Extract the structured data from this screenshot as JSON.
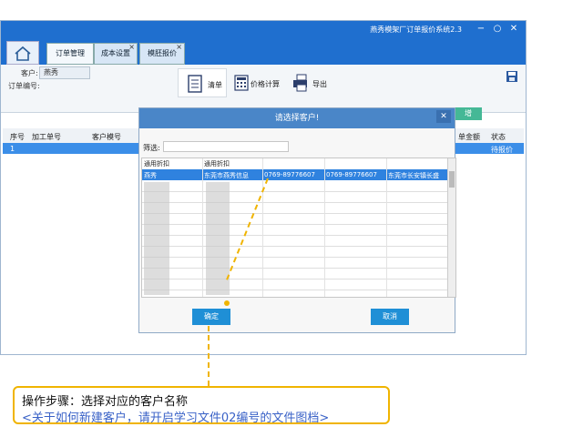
{
  "window": {
    "title": "燕秀模架厂订单报价系统2.3"
  },
  "tabs": [
    {
      "label": "订单管理"
    },
    {
      "label": "成本设置"
    },
    {
      "label": "模胚报价"
    }
  ],
  "customer": {
    "label": "客户:",
    "value": "燕秀",
    "order_label": "订单编号:"
  },
  "toolbar": {
    "list": "清单",
    "price": "价格计算",
    "export": "导出"
  },
  "grid": {
    "headers": [
      "序号",
      "加工单号",
      "客户模号",
      "单金额",
      "状态"
    ],
    "row": {
      "index": "1",
      "status": "待报价"
    }
  },
  "modal": {
    "title": "请选择客户!",
    "filter_label": "筛选:",
    "columns": [
      "通用折扣",
      "通用折扣"
    ],
    "selected_row": [
      "燕秀",
      "东莞市燕秀信息",
      "0769-89776607",
      "0769-89776607",
      "东莞市长安镇长盛"
    ],
    "ok": "确定",
    "cancel": "取消"
  },
  "note": {
    "line1": "操作步骤：选择对应的客户名称",
    "line2": "<关于如何新建客户，请开启学习文件02编号的文件图档>"
  }
}
